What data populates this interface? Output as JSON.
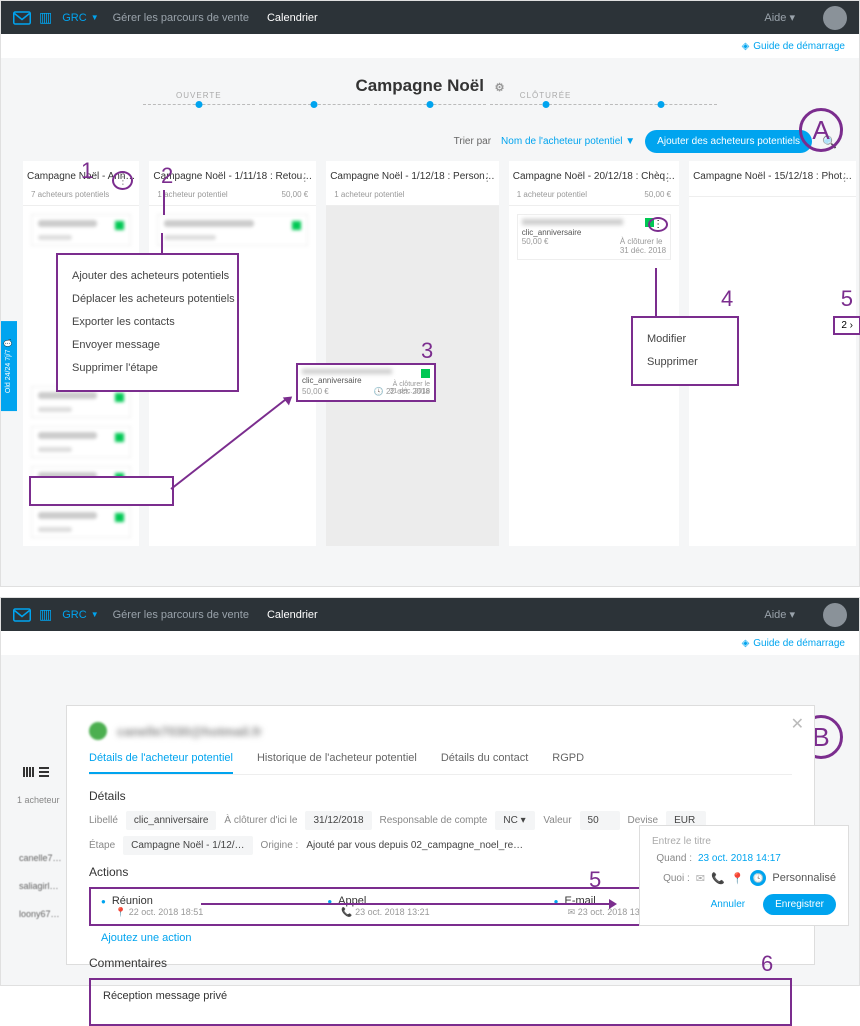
{
  "nav": {
    "grc": "GRC",
    "manage": "Gérer les parcours de vente",
    "calendar": "Calendrier",
    "help": "Aide"
  },
  "subbar": {
    "guide": "Guide de démarrage"
  },
  "letters": {
    "A": "A",
    "B": "B"
  },
  "numbers": {
    "n1": "1",
    "n2": "2",
    "n3": "3",
    "n4": "4",
    "n5": "5",
    "n5b": "5",
    "n6": "6"
  },
  "campaign": {
    "title": "Campagne Noël",
    "track_open": "OUVERTE",
    "track_closed": "CLÔTURÉE"
  },
  "sort": {
    "label": "Trier par",
    "value": "Nom de l'acheteur potentiel",
    "button": "Ajouter des acheteurs potentiels"
  },
  "cols": [
    {
      "title": "Campagne Noël - Ann…",
      "meta_left": "7 acheteurs potentiels",
      "meta_right": ""
    },
    {
      "title": "Campagne Noël - 1/11/18 : Retou…",
      "meta_left": "1 acheteur potentiel",
      "meta_right": "50,00 €"
    },
    {
      "title": "Campagne Noël - 1/12/18 : Person…",
      "meta_left": "1 acheteur potentiel",
      "meta_right": ""
    },
    {
      "title": "Campagne Noël - 20/12/18 : Chèq…",
      "meta_left": "1 acheteur potentiel",
      "meta_right": "50,00 €"
    },
    {
      "title": "Campagne Noël - 15/12/18 : Phot…",
      "meta_left": "",
      "meta_right": ""
    }
  ],
  "ctx1": {
    "i1": "Ajouter des acheteurs potentiels",
    "i2": "Déplacer les acheteurs potentiels",
    "i3": "Exporter les contacts",
    "i4": "Envoyer message",
    "i5": "Supprimer l'étape"
  },
  "ctx2": {
    "i1": "Modifier",
    "i2": "Supprimer"
  },
  "pager": {
    "val": "2"
  },
  "minicard": {
    "title": "clic_anniversaire",
    "date_label": "À clôturer le",
    "date": "31 déc. 2018",
    "price": "50,00 €",
    "footer_date": "22 oct. 2018"
  },
  "col4card": {
    "title": "clic_anniversaire",
    "date_label": "À clôturer le",
    "date": "31 déc. 2018",
    "price": "50,00 €"
  },
  "panelB": {
    "list_count": "1 acheteur",
    "side_names": [
      "canelle70…",
      "saliagirl@…",
      "loony67@…"
    ],
    "modal_title": "canelle7030@hotmail.fr",
    "tabs": {
      "t1": "Détails de l'acheteur potentiel",
      "t2": "Historique de l'acheteur potentiel",
      "t3": "Détails du contact",
      "t4": "RGPD"
    },
    "details_h": "Détails",
    "details": {
      "libelle_l": "Libellé",
      "libelle_v": "clic_anniversaire",
      "cloture_l": "À clôturer d'ici le",
      "cloture_v": "31/12/2018",
      "resp_l": "Responsable de compte",
      "resp_v": "NC",
      "valeur_l": "Valeur",
      "valeur_v": "50",
      "devise_l": "Devise",
      "devise_v": "EUR",
      "etape_l": "Étape",
      "etape_v": "Campagne Noël - 1/12/…",
      "origine_l": "Origine :",
      "origine_v": "Ajouté par vous depuis 02_campagne_noel_re…"
    },
    "actions_h": "Actions",
    "actions": [
      {
        "name": "Réunion",
        "date": "22 oct. 2018 18:51",
        "icon": "📍"
      },
      {
        "name": "Appel",
        "date": "23 oct. 2018 13:21",
        "icon": "📞"
      },
      {
        "name": "E-mail",
        "date": "23 oct. 2018 13:21",
        "icon": "✉"
      }
    ],
    "add_action": "Ajoutez une action",
    "comments_h": "Commentaires",
    "comment_text": "Réception message privé",
    "sidepanel": {
      "title_ph": "Entrez le titre",
      "when_l": "Quand :",
      "when_v": "23 oct. 2018 14:17",
      "what_l": "Quoi :",
      "custom": "Personnalisé",
      "cancel": "Annuler",
      "save": "Enregistrer"
    }
  }
}
